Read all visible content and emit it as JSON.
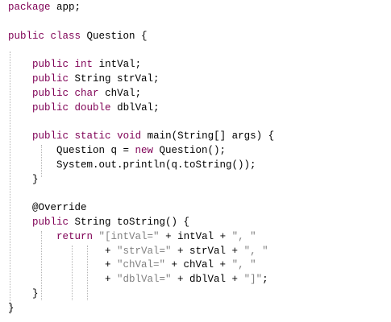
{
  "editor": {
    "language": "java",
    "colors": {
      "background": "#ffffff",
      "keyword": "#7f0055",
      "string": "#808080",
      "plain": "#000000",
      "indent_guide": "#b5b5b5"
    },
    "lines": [
      {
        "tokens": [
          {
            "t": "package",
            "c": "kw"
          },
          {
            "t": " app;",
            "c": "plain"
          }
        ]
      },
      {
        "tokens": []
      },
      {
        "tokens": [
          {
            "t": "public",
            "c": "kw"
          },
          {
            "t": " ",
            "c": "plain"
          },
          {
            "t": "class",
            "c": "kw"
          },
          {
            "t": " Question {",
            "c": "plain"
          }
        ]
      },
      {
        "tokens": []
      },
      {
        "tokens": [
          {
            "t": "    ",
            "c": "plain"
          },
          {
            "t": "public",
            "c": "kw"
          },
          {
            "t": " ",
            "c": "plain"
          },
          {
            "t": "int",
            "c": "kw"
          },
          {
            "t": " intVal;",
            "c": "plain"
          }
        ]
      },
      {
        "tokens": [
          {
            "t": "    ",
            "c": "plain"
          },
          {
            "t": "public",
            "c": "kw"
          },
          {
            "t": " String strVal;",
            "c": "plain"
          }
        ]
      },
      {
        "tokens": [
          {
            "t": "    ",
            "c": "plain"
          },
          {
            "t": "public",
            "c": "kw"
          },
          {
            "t": " ",
            "c": "plain"
          },
          {
            "t": "char",
            "c": "kw"
          },
          {
            "t": " chVal;",
            "c": "plain"
          }
        ]
      },
      {
        "tokens": [
          {
            "t": "    ",
            "c": "plain"
          },
          {
            "t": "public",
            "c": "kw"
          },
          {
            "t": " ",
            "c": "plain"
          },
          {
            "t": "double",
            "c": "kw"
          },
          {
            "t": " dblVal;",
            "c": "plain"
          }
        ]
      },
      {
        "tokens": []
      },
      {
        "tokens": [
          {
            "t": "    ",
            "c": "plain"
          },
          {
            "t": "public",
            "c": "kw"
          },
          {
            "t": " ",
            "c": "plain"
          },
          {
            "t": "static",
            "c": "kw"
          },
          {
            "t": " ",
            "c": "plain"
          },
          {
            "t": "void",
            "c": "kw"
          },
          {
            "t": " main(String[] args) {",
            "c": "plain"
          }
        ]
      },
      {
        "tokens": [
          {
            "t": "        Question q = ",
            "c": "plain"
          },
          {
            "t": "new",
            "c": "kw"
          },
          {
            "t": " Question();",
            "c": "plain"
          }
        ]
      },
      {
        "tokens": [
          {
            "t": "        System.out.println(q.toString());",
            "c": "plain"
          }
        ]
      },
      {
        "tokens": [
          {
            "t": "    }",
            "c": "plain"
          }
        ]
      },
      {
        "tokens": []
      },
      {
        "tokens": [
          {
            "t": "    @Override",
            "c": "plain"
          }
        ]
      },
      {
        "tokens": [
          {
            "t": "    ",
            "c": "plain"
          },
          {
            "t": "public",
            "c": "kw"
          },
          {
            "t": " String toString() {",
            "c": "plain"
          }
        ]
      },
      {
        "tokens": [
          {
            "t": "        ",
            "c": "plain"
          },
          {
            "t": "return",
            "c": "kw"
          },
          {
            "t": " ",
            "c": "plain"
          },
          {
            "t": "\"[intVal=\"",
            "c": "str"
          },
          {
            "t": " + intVal + ",
            "c": "plain"
          },
          {
            "t": "\", \"",
            "c": "str"
          }
        ]
      },
      {
        "tokens": [
          {
            "t": "                + ",
            "c": "plain"
          },
          {
            "t": "\"strVal=\"",
            "c": "str"
          },
          {
            "t": " + strVal + ",
            "c": "plain"
          },
          {
            "t": "\", \"",
            "c": "str"
          }
        ]
      },
      {
        "tokens": [
          {
            "t": "                + ",
            "c": "plain"
          },
          {
            "t": "\"chVal=\"",
            "c": "str"
          },
          {
            "t": " + chVal + ",
            "c": "plain"
          },
          {
            "t": "\", \"",
            "c": "str"
          }
        ]
      },
      {
        "tokens": [
          {
            "t": "                + ",
            "c": "plain"
          },
          {
            "t": "\"dblVal=\"",
            "c": "str"
          },
          {
            "t": " + dblVal + ",
            "c": "plain"
          },
          {
            "t": "\"]\"",
            "c": "str"
          },
          {
            "t": ";",
            "c": "plain"
          }
        ]
      },
      {
        "tokens": [
          {
            "t": "    }",
            "c": "plain"
          }
        ]
      },
      {
        "tokens": [
          {
            "t": "}",
            "c": "plain"
          }
        ]
      }
    ]
  }
}
